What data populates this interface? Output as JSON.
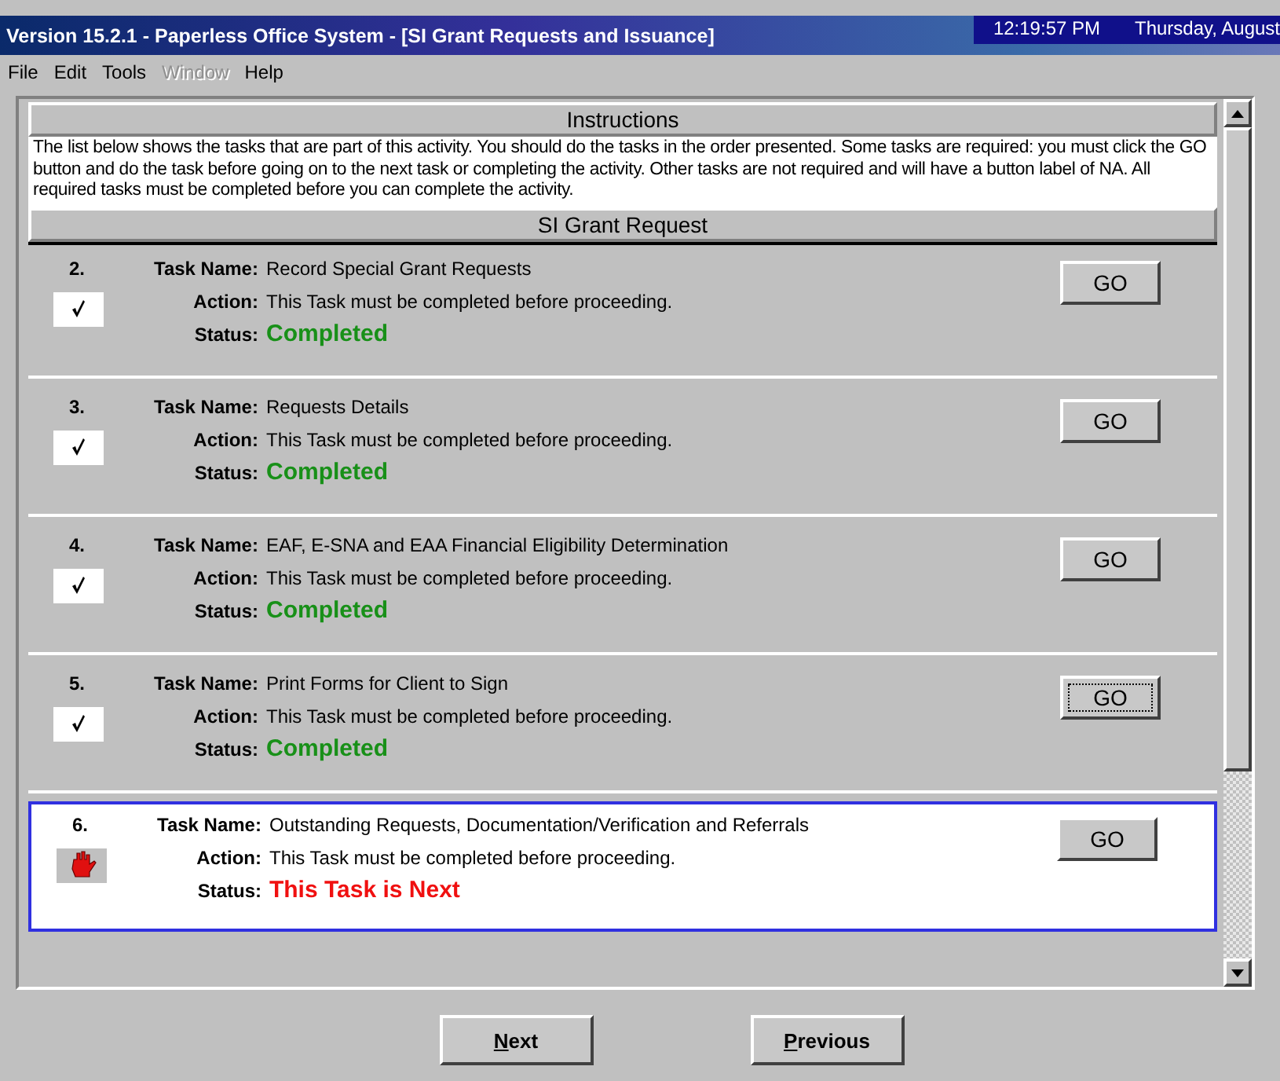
{
  "window": {
    "title": "Version 15.2.1 - Paperless Office System - [SI Grant Requests and Issuance]",
    "time": "12:19:57 PM",
    "date": "Thursday, August"
  },
  "menu": [
    {
      "label": "File",
      "disabled": false
    },
    {
      "label": "Edit",
      "disabled": false
    },
    {
      "label": "Tools",
      "disabled": false
    },
    {
      "label": "Window",
      "disabled": true
    },
    {
      "label": "Help",
      "disabled": false
    }
  ],
  "instructions": {
    "heading": "Instructions",
    "text": "The list below shows the tasks that are part of this activity.  You should do the tasks in the order presented.  Some tasks are required: you must click the GO button and do the task before going on to the next task or completing the activity.  Other tasks are not required and will have a button label of NA.  All required tasks must be completed before you can complete the activity."
  },
  "section": "SI Grant Request",
  "tasks": [
    {
      "number": "2.",
      "name_label": "Task Name:",
      "name": "Record Special Grant Requests",
      "action_label": "Action:",
      "action": "This Task must be completed before proceeding.",
      "status_label": "Status:",
      "status": "Completed",
      "kind": "completed",
      "selected": false,
      "button": "GO",
      "focused": false
    },
    {
      "number": "3.",
      "name_label": "Task Name:",
      "name": "Requests Details",
      "action_label": "Action:",
      "action": "This Task must be completed before proceeding.",
      "status_label": "Status:",
      "status": "Completed",
      "kind": "completed",
      "selected": false,
      "button": "GO",
      "focused": false
    },
    {
      "number": "4.",
      "name_label": "Task Name:",
      "name": "EAF, E-SNA and EAA Financial Eligibility Determination",
      "action_label": "Action:",
      "action": "This Task must be completed before proceeding.",
      "status_label": "Status:",
      "status": "Completed",
      "kind": "completed",
      "selected": false,
      "button": "GO",
      "focused": false
    },
    {
      "number": "5.",
      "name_label": "Task Name:",
      "name": "Print Forms for Client to Sign",
      "action_label": "Action:",
      "action": "This Task must be completed before proceeding.",
      "status_label": "Status:",
      "status": "Completed",
      "kind": "completed",
      "selected": false,
      "button": "GO",
      "focused": true
    },
    {
      "number": "6.",
      "name_label": "Task Name:",
      "name": "Outstanding Requests, Documentation/Verification and Referrals",
      "action_label": "Action:",
      "action": "This Task must be completed before proceeding.",
      "status_label": "Status:",
      "status": "This Task is Next",
      "kind": "next",
      "selected": true,
      "button": "GO",
      "focused": false
    }
  ],
  "buttons": [
    {
      "label": "Next"
    },
    {
      "label": "Previous"
    }
  ]
}
